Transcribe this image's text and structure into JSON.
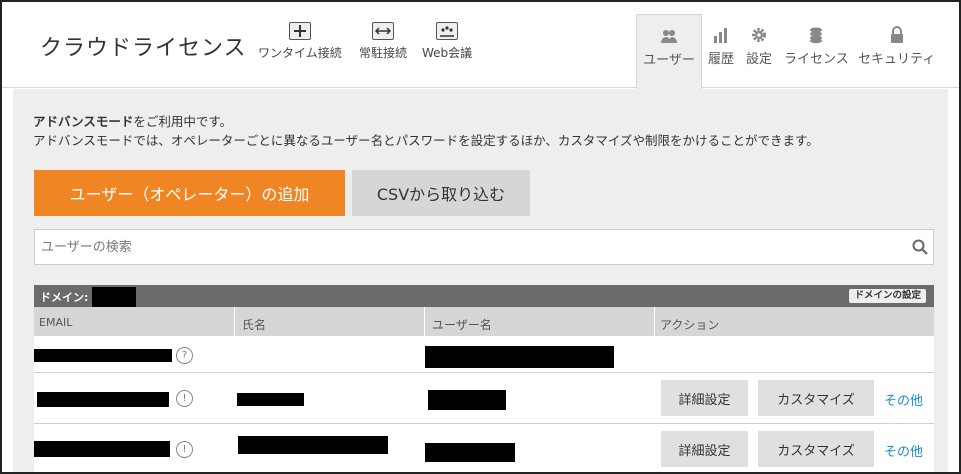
{
  "header": {
    "app_title": "クラウドライセンス",
    "connections": [
      {
        "label": "ワンタイム接続",
        "icon": "onetime-connect-icon"
      },
      {
        "label": "常駐接続",
        "icon": "resident-connect-icon"
      },
      {
        "label": "Web会議",
        "icon": "web-meeting-icon"
      }
    ],
    "nav": [
      {
        "label": "ユーザー",
        "icon": "users-icon",
        "active": true
      },
      {
        "label": "履歴",
        "icon": "bar-chart-icon"
      },
      {
        "label": "設定",
        "icon": "gear-icon"
      },
      {
        "label": "ライセンス",
        "icon": "coins-icon"
      },
      {
        "label": "セキュリティ",
        "icon": "lock-icon"
      }
    ]
  },
  "main": {
    "info_bold": "アドバンスモード",
    "info_line1_rest": "をご利用中です。",
    "info_line2": "アドバンスモードでは、オペレーターごとに異なるユーザー名とパスワードを設定するほか、カスタマイズや制限をかけることができます。",
    "add_button": "ユーザー（オペレーター）の追加",
    "csv_button": "CSVから取り込む",
    "search_placeholder": "ユーザーの検索",
    "domain_label": "ドメイン:",
    "domain_settings": "ドメインの設定",
    "columns": [
      "EMAIL",
      "氏名",
      "ユーザー名",
      "アクション"
    ],
    "row_icons": {
      "row1": "?",
      "row2": "!",
      "row3": "!"
    },
    "actions": {
      "detail": "詳細設定",
      "customize": "カスタマイズ",
      "other": "その他"
    }
  },
  "colors": {
    "accent": "#f08524",
    "link": "#1a8cd8",
    "panel": "#eeeeee"
  }
}
